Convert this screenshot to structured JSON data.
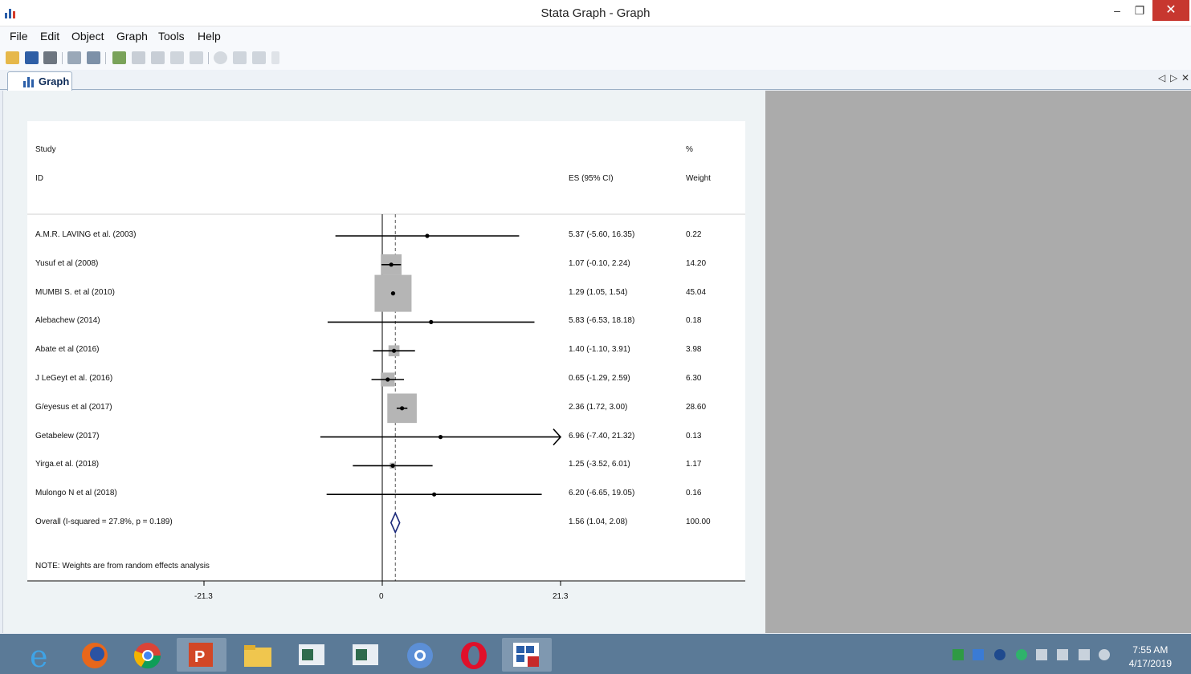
{
  "window": {
    "title": "Stata Graph - Graph",
    "min_glyph": "–",
    "restore_glyph": "❐",
    "close_glyph": "✕"
  },
  "menu": [
    "File",
    "Edit",
    "Object",
    "Graph",
    "Tools",
    "Help"
  ],
  "toolbar": {
    "icons": [
      "open-icon",
      "save-icon",
      "print-icon",
      "copy-icon",
      "copy-graph-icon",
      "graph-editor-icon",
      "rename-icon",
      "pointer-icon",
      "undo-icon",
      "redo-icon",
      "record-icon",
      "pause-icon",
      "play-icon",
      "more-icon"
    ]
  },
  "tabs": {
    "active_label": "Graph",
    "nav_left": "◁",
    "nav_right": "▷",
    "nav_close": "✕"
  },
  "forest_plot": {
    "header_study": "Study",
    "header_id": "ID",
    "header_es": "ES (95% CI)",
    "header_pct": "%",
    "header_weight": "Weight",
    "note": "NOTE: Weights are from random effects analysis",
    "axis_ticks": [
      "-21.3",
      "0",
      "21.3"
    ]
  },
  "chart_data": {
    "type": "forest",
    "x_axis_ticks": [
      -21.3,
      0,
      21.3
    ],
    "xlim": [
      -21.3,
      21.3
    ],
    "overall_line": 1.56,
    "studies": [
      {
        "id": "A.M.R.  LAVING et al. (2003)",
        "es": 5.37,
        "lo": -5.6,
        "hi": 16.35,
        "ci": "5.37 (-5.60, 16.35)",
        "weight": "0.22",
        "w": 0.22
      },
      {
        "id": "Yusuf et al (2008)",
        "es": 1.07,
        "lo": -0.1,
        "hi": 2.24,
        "ci": "1.07 (-0.10, 2.24)",
        "weight": "14.20",
        "w": 14.2
      },
      {
        "id": "MUMBI S.  et al (2010)",
        "es": 1.29,
        "lo": 1.05,
        "hi": 1.54,
        "ci": "1.29 (1.05, 1.54)",
        "weight": "45.04",
        "w": 45.04
      },
      {
        "id": "Alebachew (2014)",
        "es": 5.83,
        "lo": -6.53,
        "hi": 18.18,
        "ci": "5.83 (-6.53, 18.18)",
        "weight": "0.18",
        "w": 0.18
      },
      {
        "id": " Abate et al (2016)",
        "es": 1.4,
        "lo": -1.1,
        "hi": 3.91,
        "ci": "1.40 (-1.10, 3.91)",
        "weight": "3.98",
        "w": 3.98
      },
      {
        "id": "J LeGeyt et al. (2016)",
        "es": 0.65,
        "lo": -1.29,
        "hi": 2.59,
        "ci": "0.65 (-1.29, 2.59)",
        "weight": "6.30",
        "w": 6.3
      },
      {
        "id": "G/eyesus et al (2017)",
        "es": 2.36,
        "lo": 1.72,
        "hi": 3.0,
        "ci": "2.36 (1.72, 3.00)",
        "weight": "28.60",
        "w": 28.6
      },
      {
        "id": "Getabelew (2017)",
        "es": 6.96,
        "lo": -7.4,
        "hi": 21.32,
        "ci": "6.96 (-7.40, 21.32)",
        "weight": "0.13",
        "w": 0.13
      },
      {
        "id": "Yirga.et al. (2018)",
        "es": 1.25,
        "lo": -3.52,
        "hi": 6.01,
        "ci": "1.25 (-3.52, 6.01)",
        "weight": "1.17",
        "w": 1.17
      },
      {
        "id": "Mulongo N et al (2018)",
        "es": 6.2,
        "lo": -6.65,
        "hi": 19.05,
        "ci": "6.20 (-6.65, 19.05)",
        "weight": "0.16",
        "w": 0.16
      }
    ],
    "overall": {
      "id": "Overall  (I-squared = 27.8%, p = 0.189)",
      "es": 1.56,
      "lo": 1.04,
      "hi": 2.08,
      "ci": "1.56 (1.04, 2.08)",
      "weight": "100.00"
    }
  },
  "taskbar": {
    "apps": [
      "internet-explorer-icon",
      "firefox-icon",
      "chrome-icon",
      "powerpoint-icon",
      "file-explorer-icon",
      "app-window-icon",
      "app-window-icon-2",
      "chromium-icon",
      "opera-icon",
      "stata-icon"
    ],
    "clock_time": "7:55 AM",
    "clock_date": "4/17/2019"
  }
}
